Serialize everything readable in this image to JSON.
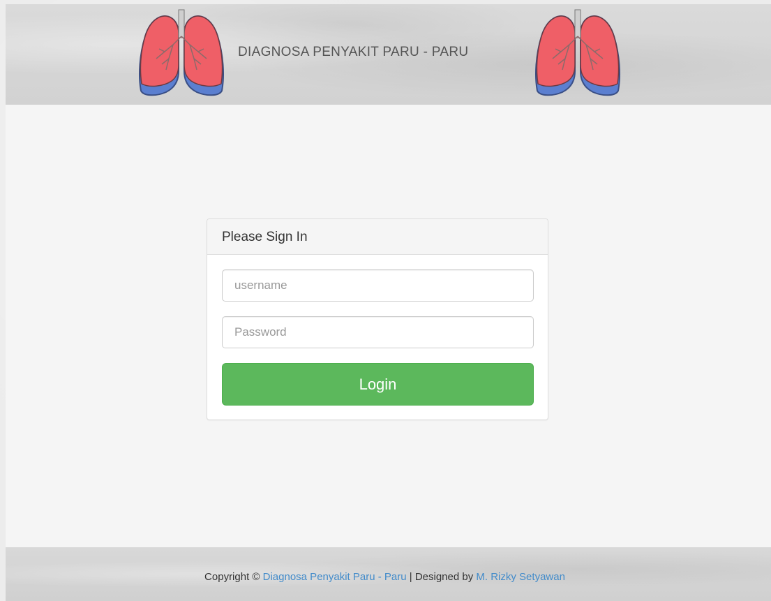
{
  "header": {
    "title": "DIAGNOSA PENYAKIT PARU - PARU",
    "left_logo_icon": "lungs-icon",
    "right_logo_icon": "lungs-icon"
  },
  "login": {
    "panel_title": "Please Sign In",
    "username": {
      "value": "",
      "placeholder": "username"
    },
    "password": {
      "value": "",
      "placeholder": "Password"
    },
    "submit_label": "Login"
  },
  "footer": {
    "copyright_prefix": "Copyright ©",
    "site_link": "Diagnosa Penyakit Paru - Paru",
    "separator": "| Designed by",
    "author_link": "M. Rizky Setyawan"
  },
  "colors": {
    "accent_button": "#5cb85c",
    "link": "#428bca",
    "lung_fill": "#ef5f67",
    "lung_base": "#5b7fd0"
  }
}
